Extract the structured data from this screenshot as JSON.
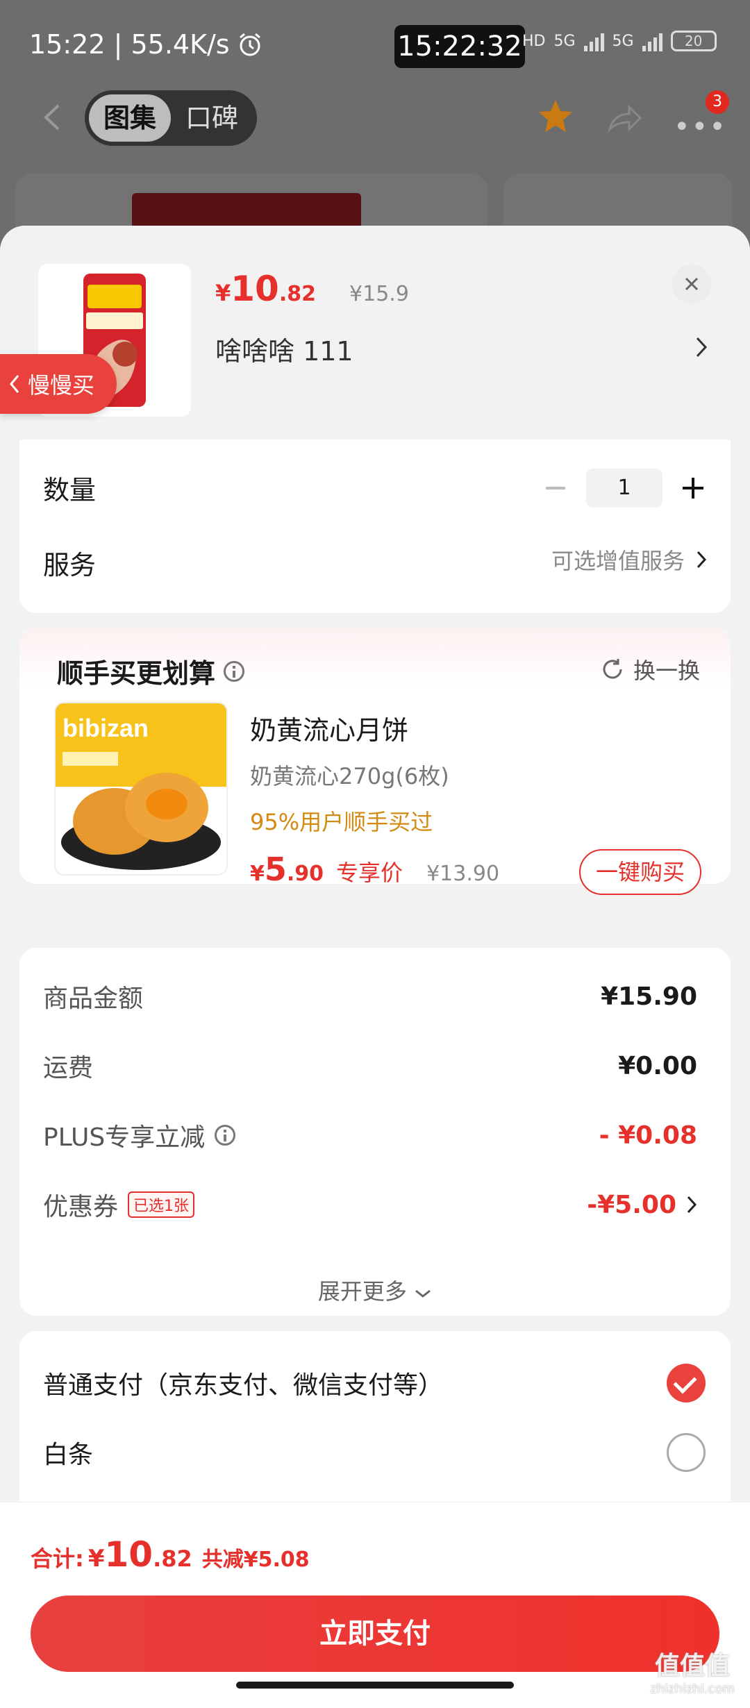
{
  "status_bar": {
    "left_text": "15:22 | 55.4K/s",
    "center_time": "15:22:32",
    "hd_label": "HD",
    "net_label": "5G",
    "battery": "20"
  },
  "nav": {
    "tabs": [
      {
        "label": "图集",
        "active": true
      },
      {
        "label": "口碑",
        "active": false
      }
    ],
    "more_badge": "3"
  },
  "product": {
    "price_symbol": "¥",
    "price_int": "10",
    "price_dec": ".82",
    "original_price": "¥15.9",
    "sku": "啥啥啥  111"
  },
  "quantity": {
    "label": "数量",
    "value": "1"
  },
  "service": {
    "label": "服务",
    "hint": "可选增值服务"
  },
  "slow_buy_tag": "慢慢买",
  "upsell": {
    "title": "顺手买更划算",
    "swap_label": "换一换",
    "name": "奶黄流心月饼",
    "spec": "奶黄流心270g(6枚)",
    "note": "95%用户顺手买过",
    "price_symbol": "¥",
    "price_int": "5",
    "price_dec": ".90",
    "price_tag": "专享价",
    "original_price": "¥13.90",
    "buy_label": "一键购买",
    "image_brand_text": "bibizan"
  },
  "summary": {
    "rows": [
      {
        "label": "商品金额",
        "value": "¥15.90"
      },
      {
        "label": "运费",
        "value": "¥0.00"
      },
      {
        "label": "PLUS专享立减",
        "value": "- ¥0.08"
      },
      {
        "label": "优惠券",
        "badge": "已选1张",
        "value": "-¥5.00"
      }
    ],
    "expand_label": "展开更多"
  },
  "payment": {
    "options": [
      {
        "label": "普通支付（京东支付、微信支付等）",
        "selected": true
      },
      {
        "label": "白条",
        "selected": false
      }
    ]
  },
  "footer": {
    "total_label": "合计:",
    "total_symbol": "¥",
    "total_int": "10",
    "total_dec": ".82",
    "total_save": "共减¥5.08",
    "pay_button": "立即支付"
  },
  "watermark": {
    "main": "值值值",
    "sub": "zhizhizhi.com"
  },
  "colors": {
    "accent_red": "#e5302b",
    "note_orange": "#d28a12"
  }
}
